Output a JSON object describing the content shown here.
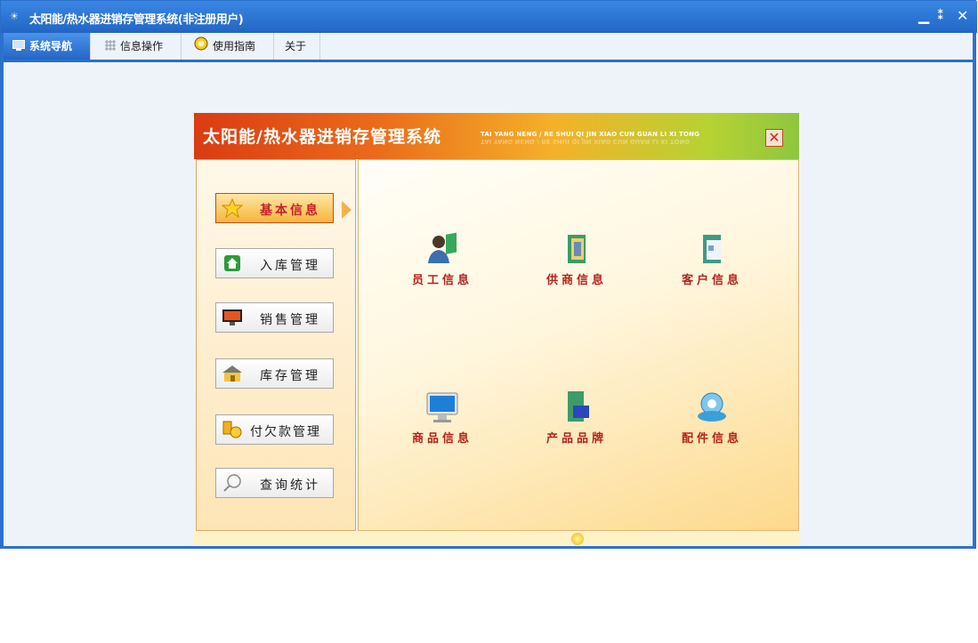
{
  "window": {
    "title": "太阳能/热水器进销存管理系统(非注册用户)",
    "app_icon": "☀",
    "controls": [
      "minimize-icon",
      "restore-icon",
      "close-icon"
    ]
  },
  "menu_tabs": [
    {
      "label": "系统导航",
      "icon": "monitor-icon",
      "active": true
    },
    {
      "label": "信息操作",
      "icon": "grid-icon",
      "active": false
    },
    {
      "label": "使用指南",
      "icon": "help-icon",
      "active": false
    },
    {
      "label": "关于",
      "icon": "",
      "active": false
    }
  ],
  "panel": {
    "title": "太阳能/热水器进销存管理系统",
    "pinyin": "TAI YANG NENG / RE SHUI QI JIN XIAO CUN GUAN LI XI TONG",
    "close_glyph": "✕"
  },
  "sidebar": [
    {
      "label": "基本信息",
      "icon": "star-icon",
      "selected": true
    },
    {
      "label": "入库管理",
      "icon": "house-icon",
      "selected": false
    },
    {
      "label": "销售管理",
      "icon": "display-icon",
      "selected": false
    },
    {
      "label": "库存管理",
      "icon": "warehouse-icon",
      "selected": false
    },
    {
      "label": "付欠款管理",
      "icon": "coins-icon",
      "selected": false
    },
    {
      "label": "查询统计",
      "icon": "magnifier-icon",
      "selected": false
    }
  ],
  "items": [
    {
      "label": "员工信息",
      "icon": "employee-icon"
    },
    {
      "label": "供商信息",
      "icon": "supplier-icon"
    },
    {
      "label": "客户信息",
      "icon": "customer-icon"
    },
    {
      "label": "商品信息",
      "icon": "computer-icon"
    },
    {
      "label": "产品品牌",
      "icon": "brand-icon"
    },
    {
      "label": "配件信息",
      "icon": "accessory-icon"
    }
  ],
  "colors": {
    "title_bar": "#2b73d1",
    "item_label": "#b5221c",
    "selected_label": "#c9202a"
  }
}
